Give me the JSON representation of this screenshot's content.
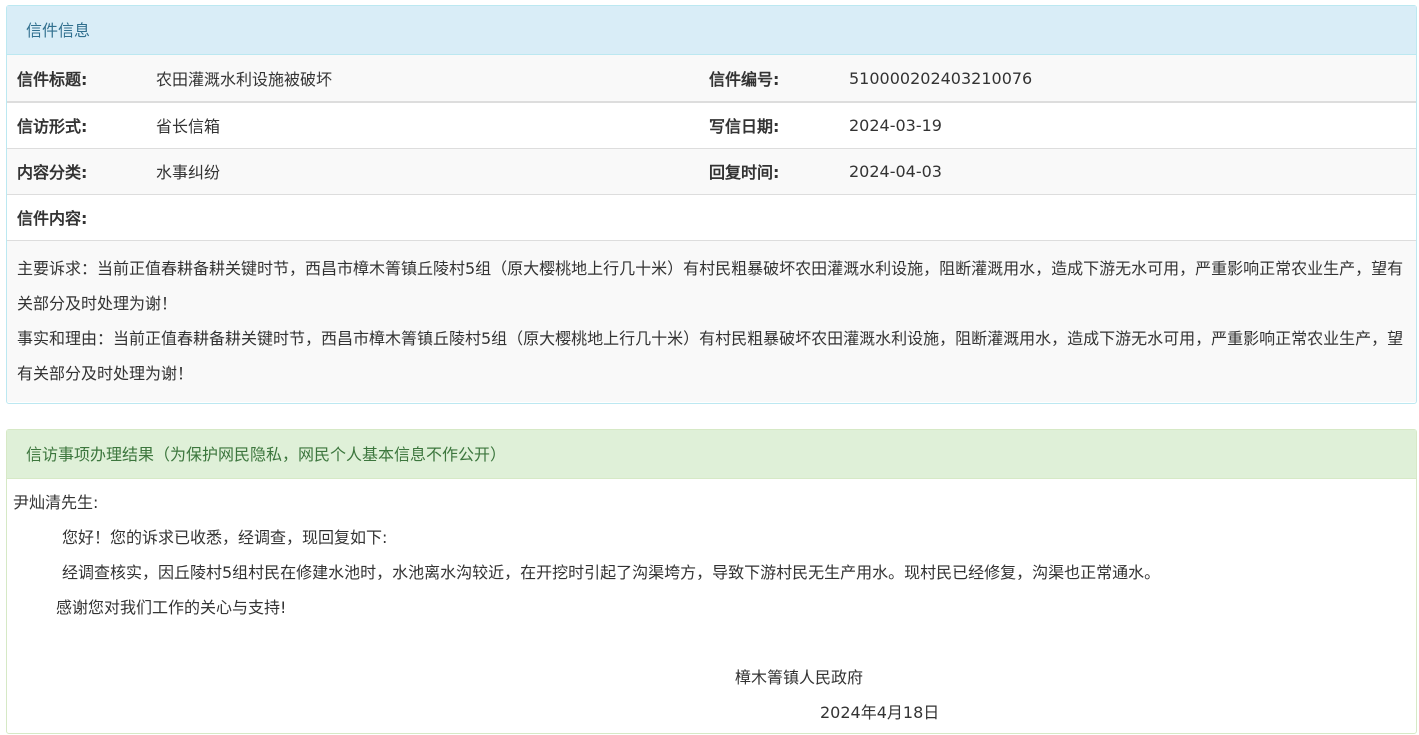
{
  "letter_panel": {
    "heading": "信件信息",
    "fields": {
      "title_label": "信件标题:",
      "title_value": "农田灌溉水利设施被破坏",
      "number_label": "信件编号:",
      "number_value": "510000202403210076",
      "form_label": "信访形式:",
      "form_value": "省长信箱",
      "write_date_label": "写信日期:",
      "write_date_value": "2024-03-19",
      "category_label": "内容分类:",
      "category_value": "水事纠纷",
      "reply_time_label": "回复时间:",
      "reply_time_value": "2024-04-03",
      "content_label": "信件内容:"
    },
    "content": {
      "demand": "主要诉求：当前正值春耕备耕关键时节，西昌市樟木箐镇丘陵村5组（原大樱桃地上行几十米）有村民粗暴破坏农田灌溉水利设施，阻断灌溉用水，造成下游无水可用，严重影响正常农业生产，望有关部分及时处理为谢！",
      "facts": "事实和理由：当前正值春耕备耕关键时节，西昌市樟木箐镇丘陵村5组（原大樱桃地上行几十米）有村民粗暴破坏农田灌溉水利设施，阻断灌溉用水，造成下游无水可用，严重影响正常农业生产，望有关部分及时处理为谢！"
    }
  },
  "result_panel": {
    "heading": "信访事项办理结果（为保护网民隐私，网民个人基本信息不作公开）",
    "greeting": "尹灿清先生:",
    "line1": "您好！您的诉求已收悉，经调查，现回复如下:",
    "line2": "经调查核实，因丘陵村5组村民在修建水池时，水池离水沟较近，在开挖时引起了沟渠垮方，导致下游村民无生产用水。现村民已经修复，沟渠也正常通水。",
    "line3": "感谢您对我们工作的关心与支持!",
    "signature_org": "樟木箐镇人民政府",
    "signature_date": "2024年4月18日"
  }
}
